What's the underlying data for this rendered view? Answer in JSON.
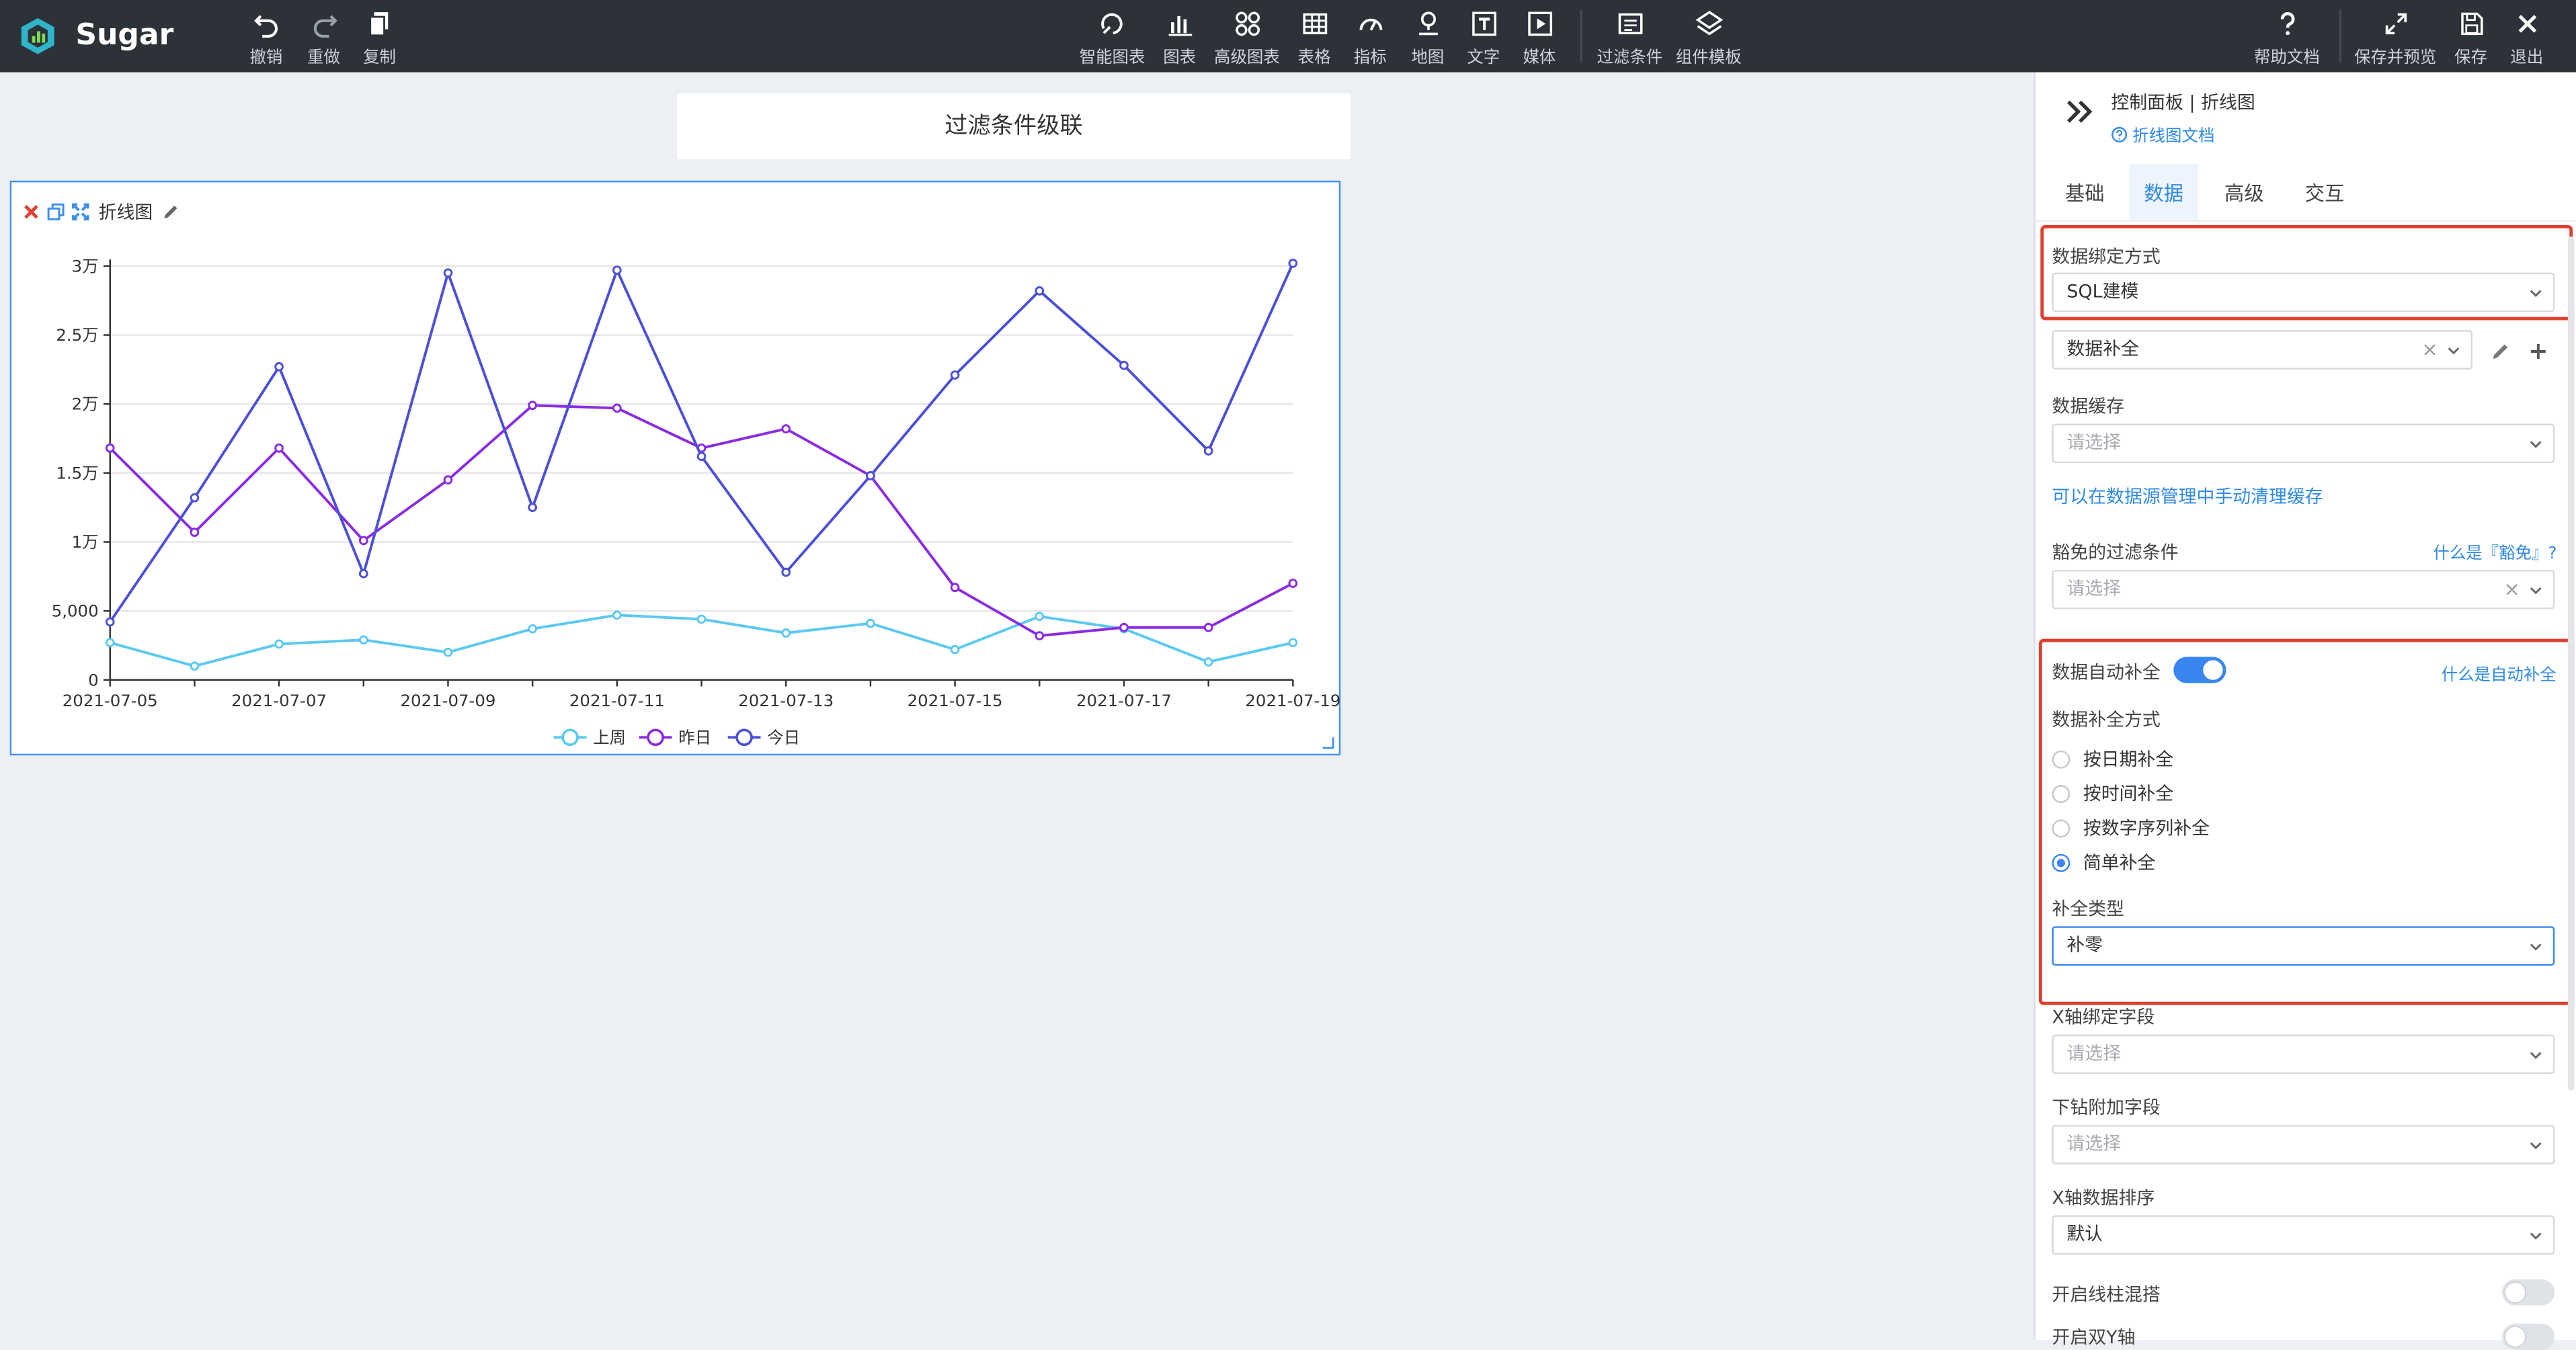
{
  "app": {
    "name": "Sugar"
  },
  "toolbar_left": [
    {
      "label": "撤销",
      "icon": "undo-icon"
    },
    {
      "label": "重做",
      "icon": "redo-icon"
    },
    {
      "label": "复制",
      "icon": "copy-icon"
    }
  ],
  "toolbar_center": [
    {
      "label": "智能图表",
      "icon": "smart-chart-icon"
    },
    {
      "label": "图表",
      "icon": "bar-chart-icon"
    },
    {
      "label": "高级图表",
      "icon": "advanced-chart-icon"
    },
    {
      "label": "表格",
      "icon": "table-icon"
    },
    {
      "label": "指标",
      "icon": "gauge-icon"
    },
    {
      "label": "地图",
      "icon": "map-pin-icon"
    },
    {
      "label": "文字",
      "icon": "text-icon"
    },
    {
      "label": "媒体",
      "icon": "media-icon"
    },
    {
      "label": "过滤条件",
      "icon": "filter-icon"
    },
    {
      "label": "组件模板",
      "icon": "template-icon"
    }
  ],
  "toolbar_right": [
    {
      "label": "帮助文档",
      "icon": "help-icon"
    },
    {
      "label": "保存并预览",
      "icon": "expand-icon"
    },
    {
      "label": "保存",
      "icon": "save-icon"
    },
    {
      "label": "退出",
      "icon": "close-icon"
    }
  ],
  "canvas": {
    "title": "过滤条件级联",
    "card_name": "折线图"
  },
  "chart_data": {
    "type": "line",
    "x": [
      "2021-07-05",
      "2021-07-06",
      "2021-07-07",
      "2021-07-08",
      "2021-07-09",
      "2021-07-10",
      "2021-07-11",
      "2021-07-12",
      "2021-07-13",
      "2021-07-14",
      "2021-07-15",
      "2021-07-16",
      "2021-07-17",
      "2021-07-18",
      "2021-07-19"
    ],
    "x_tick_labels": [
      "2021-07-05",
      "2021-07-07",
      "2021-07-09",
      "2021-07-11",
      "2021-07-13",
      "2021-07-15",
      "2021-07-17",
      "2021-07-19"
    ],
    "y_tick_labels": [
      "0",
      "5,000",
      "1万",
      "1.5万",
      "2万",
      "2.5万",
      "3万"
    ],
    "ylim": [
      0,
      30000
    ],
    "grid": true,
    "legend_position": "bottom",
    "series": [
      {
        "name": "上周",
        "color": "#5bc9f0",
        "values": [
          2700,
          1000,
          2600,
          2900,
          2000,
          3700,
          4700,
          4400,
          3400,
          4100,
          2200,
          4600,
          3700,
          1300,
          2700
        ]
      },
      {
        "name": "昨日",
        "color": "#8a2be2",
        "values": [
          16800,
          10700,
          16800,
          10100,
          14500,
          19900,
          19700,
          16800,
          18200,
          14800,
          6700,
          3200,
          3800,
          3800,
          7000
        ]
      },
      {
        "name": "今日",
        "color": "#4b4fd8",
        "values": [
          4200,
          13200,
          22700,
          7700,
          29500,
          12500,
          29700,
          16200,
          7800,
          14800,
          22100,
          28200,
          22800,
          16600,
          30200
        ]
      }
    ]
  },
  "panel": {
    "breadcrumb": "控制面板 | 折线图",
    "doc_link": "折线图文档",
    "tabs": [
      "基础",
      "数据",
      "高级",
      "交互"
    ],
    "active_tab": "数据",
    "binding_label": "数据绑定方式",
    "binding_value": "SQL建模",
    "model_value": "数据补全",
    "cache_label": "数据缓存",
    "cache_placeholder": "请选择",
    "cache_link": "可以在数据源管理中手动清理缓存",
    "exempt_label": "豁免的过滤条件",
    "exempt_help": "什么是『豁免』?",
    "exempt_placeholder": "请选择",
    "autofill_label": "数据自动补全",
    "autofill_help": "什么是自动补全",
    "autofill_on": true,
    "fill_mode_label": "数据补全方式",
    "fill_modes": [
      "按日期补全",
      "按时间补全",
      "按数字序列补全",
      "简单补全"
    ],
    "fill_mode_selected": "简单补全",
    "fill_type_label": "补全类型",
    "fill_type_value": "补零",
    "x_field_label": "X轴绑定字段",
    "x_field_placeholder": "请选择",
    "drill_label": "下钻附加字段",
    "drill_placeholder": "请选择",
    "sort_label": "X轴数据排序",
    "sort_value": "默认",
    "mix_label": "开启线柱混搭",
    "dual_axis_label": "开启双Y轴"
  },
  "colors": {
    "topbar": "#2d3138",
    "accent": "#2f8ae5",
    "highlight": "#e0402f"
  }
}
